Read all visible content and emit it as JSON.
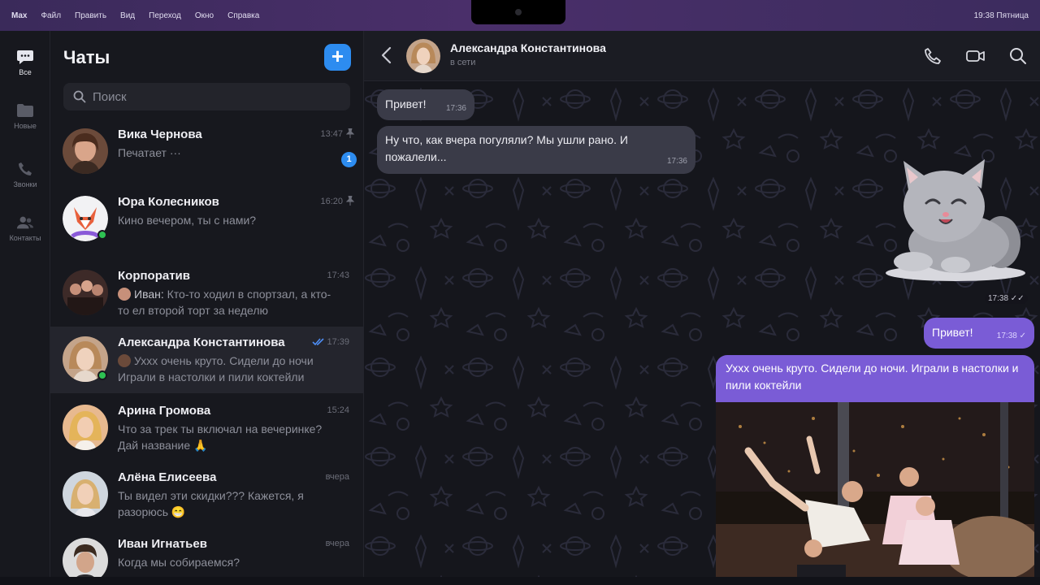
{
  "menubar": {
    "items": [
      "Max",
      "Файл",
      "Править",
      "Вид",
      "Переход",
      "Окно",
      "Справка"
    ],
    "clock": "19:38 Пятница"
  },
  "rail": {
    "items": [
      {
        "label": "Все",
        "icon": "chat-bubble-icon"
      },
      {
        "label": "Новые",
        "icon": "folder-icon"
      },
      {
        "label": "Звонки",
        "icon": "phone-icon"
      },
      {
        "label": "Контакты",
        "icon": "contacts-icon"
      }
    ]
  },
  "chatlist": {
    "title": "Чаты",
    "new_button": "+",
    "search_placeholder": "Поиск",
    "chats": [
      {
        "name": "Вика Чернова",
        "time": "13:47",
        "preview": "Печатает ···",
        "unread": "1",
        "pinned": true
      },
      {
        "name": "Юра Колесников",
        "time": "16:20",
        "preview": "Кино вечером, ты с нами?",
        "pinned": true
      },
      {
        "name": "Корпоратив",
        "time": "17:43",
        "sender": "Иван:",
        "preview": "Кто-то ходил в спортзал, а кто-то ел второй торт за неделю"
      },
      {
        "name": "Александра Константинова",
        "time": "17:39",
        "preview": "Уххх очень круто. Сидели до ночи Играли в настолки и пили коктейли"
      },
      {
        "name": "Арина Громова",
        "time": "15:24",
        "preview": "Что за трек ты включал на вечеринке? Дай название 🙏"
      },
      {
        "name": "Алёна Елисеева",
        "time": "вчера",
        "preview": "Ты видел эти скидки??? Кажется, я разорюсь 😁"
      },
      {
        "name": "Иван Игнатьев",
        "time": "вчера",
        "preview": "Когда мы собираемся?"
      }
    ]
  },
  "chat": {
    "contact_name": "Александра Константинова",
    "status": "в сети",
    "messages": [
      {
        "dir": "in",
        "text": "Привет!",
        "time": "17:36"
      },
      {
        "dir": "in",
        "text": "Ну что, как вчера погуляли? Мы ушли рано. И пожалели...",
        "time": "17:36"
      },
      {
        "dir": "out",
        "type": "sticker",
        "sticker": "cat-sticker",
        "time": "17:38"
      },
      {
        "dir": "out",
        "text": "Привет!",
        "time": "17:38"
      },
      {
        "dir": "out",
        "type": "photo",
        "text": "Уххх очень круто. Сидели до ночи. Играли в настолки и пили коктейли"
      }
    ]
  },
  "colors": {
    "accent_blue": "#2d8cf0",
    "outgoing_bubble": "#7a5cd6",
    "incoming_bubble": "#3a3b48",
    "online": "#2ec152"
  }
}
